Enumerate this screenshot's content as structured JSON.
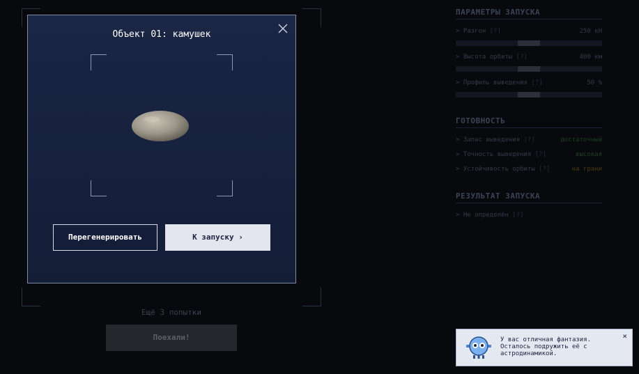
{
  "background": {
    "attempts_text": "Ещё 3 попытки",
    "go_button": "Поехали!"
  },
  "launch_params": {
    "title": "ПАРАМЕТРЫ ЗАПУСКА",
    "params": [
      {
        "label": "> Разгон",
        "help": "[?]",
        "value": "250 кН",
        "level": 0.5
      },
      {
        "label": "> Высота орбиты",
        "help": "[?]",
        "value": "400 км",
        "level": 0.5
      },
      {
        "label": "> Профиль выведения",
        "help": "[?]",
        "value": "50 %",
        "level": 0.5
      }
    ]
  },
  "readiness": {
    "title": "ГОТОВНОСТЬ",
    "items": [
      {
        "label": "> Запас выведения",
        "help": "[?]",
        "status": "достаточный",
        "color": "#1d4324"
      },
      {
        "label": "> Точность выведения",
        "help": "[?]",
        "status": "высокая",
        "color": "#1d4324"
      },
      {
        "label": "> Устойчивость орбиты",
        "help": "[?]",
        "status": "на грани",
        "color": "#4a3a12"
      }
    ]
  },
  "result": {
    "title": "РЕЗУЛЬТАТ ЗАПУСКА",
    "label": "> Не определён",
    "help": "[?]"
  },
  "modal": {
    "title": "Объект 01: камушек",
    "regen_button": "Перегенерировать",
    "launch_button": "К запуску ›"
  },
  "toast": {
    "line1": "У вас отличная фантазия.",
    "line2": "Осталось подружить её с",
    "line3": "астродинамикой.",
    "close": "×"
  },
  "icons": {
    "close": "close-icon",
    "avatar": "robot-mascot-icon",
    "object": "pebble-image"
  }
}
